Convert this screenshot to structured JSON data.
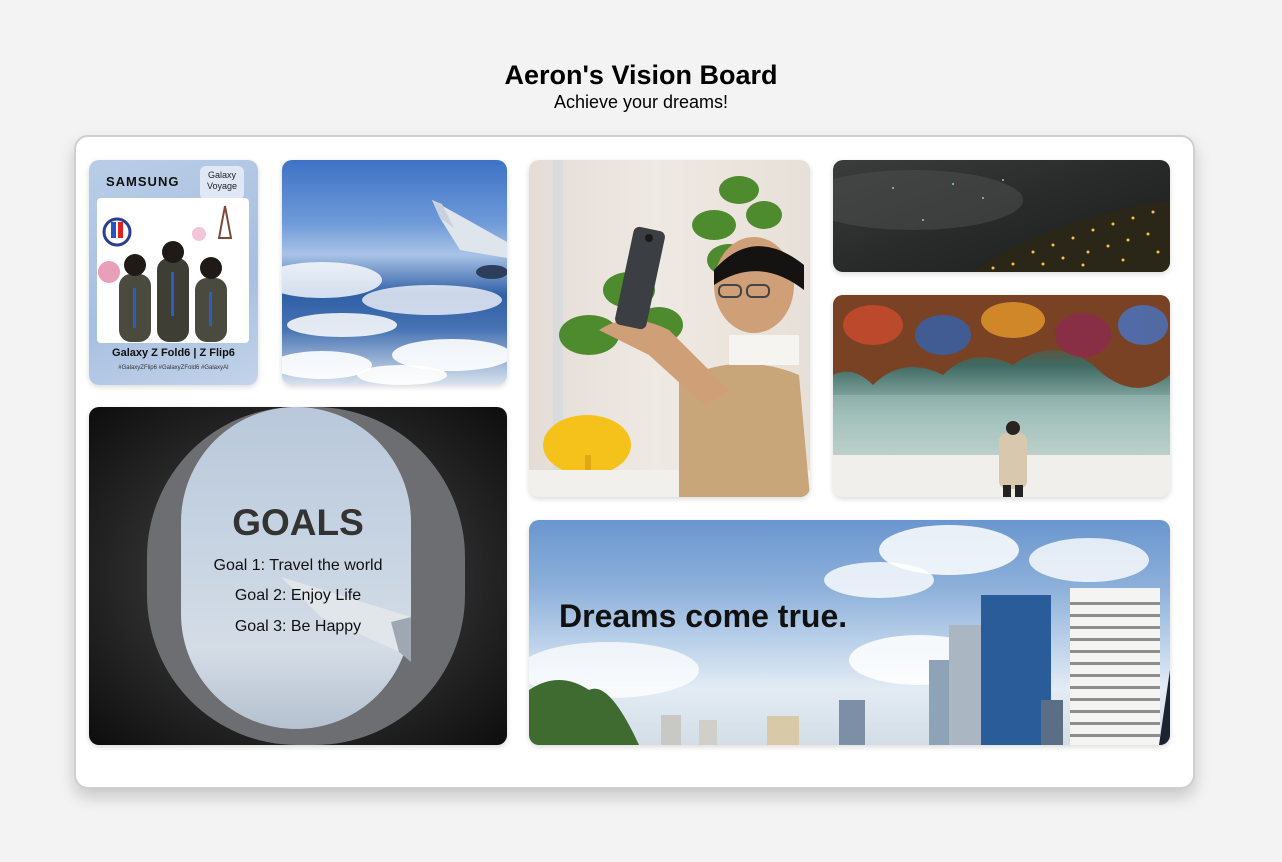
{
  "header": {
    "title": "Aeron's Vision Board",
    "subtitle": "Achieve your dreams!"
  },
  "card": {
    "brand": "SAMSUNG",
    "badge": "Galaxy Voyage",
    "caption": "Galaxy Z Fold6 | Z Flip6",
    "tags": "#GalaxyZFlip6 #GalaxyZFold6 #GalaxyAI"
  },
  "goals": {
    "title": "GOALS",
    "items": [
      "Goal 1: Travel the world",
      "Goal 2: Enjoy Life",
      "Goal 3: Be Happy"
    ]
  },
  "dreams": {
    "quote": "Dreams come true."
  },
  "colors": {
    "page_bg": "#f3f3f3",
    "board_bg": "#ffffff",
    "board_border": "#cfcfcf"
  }
}
